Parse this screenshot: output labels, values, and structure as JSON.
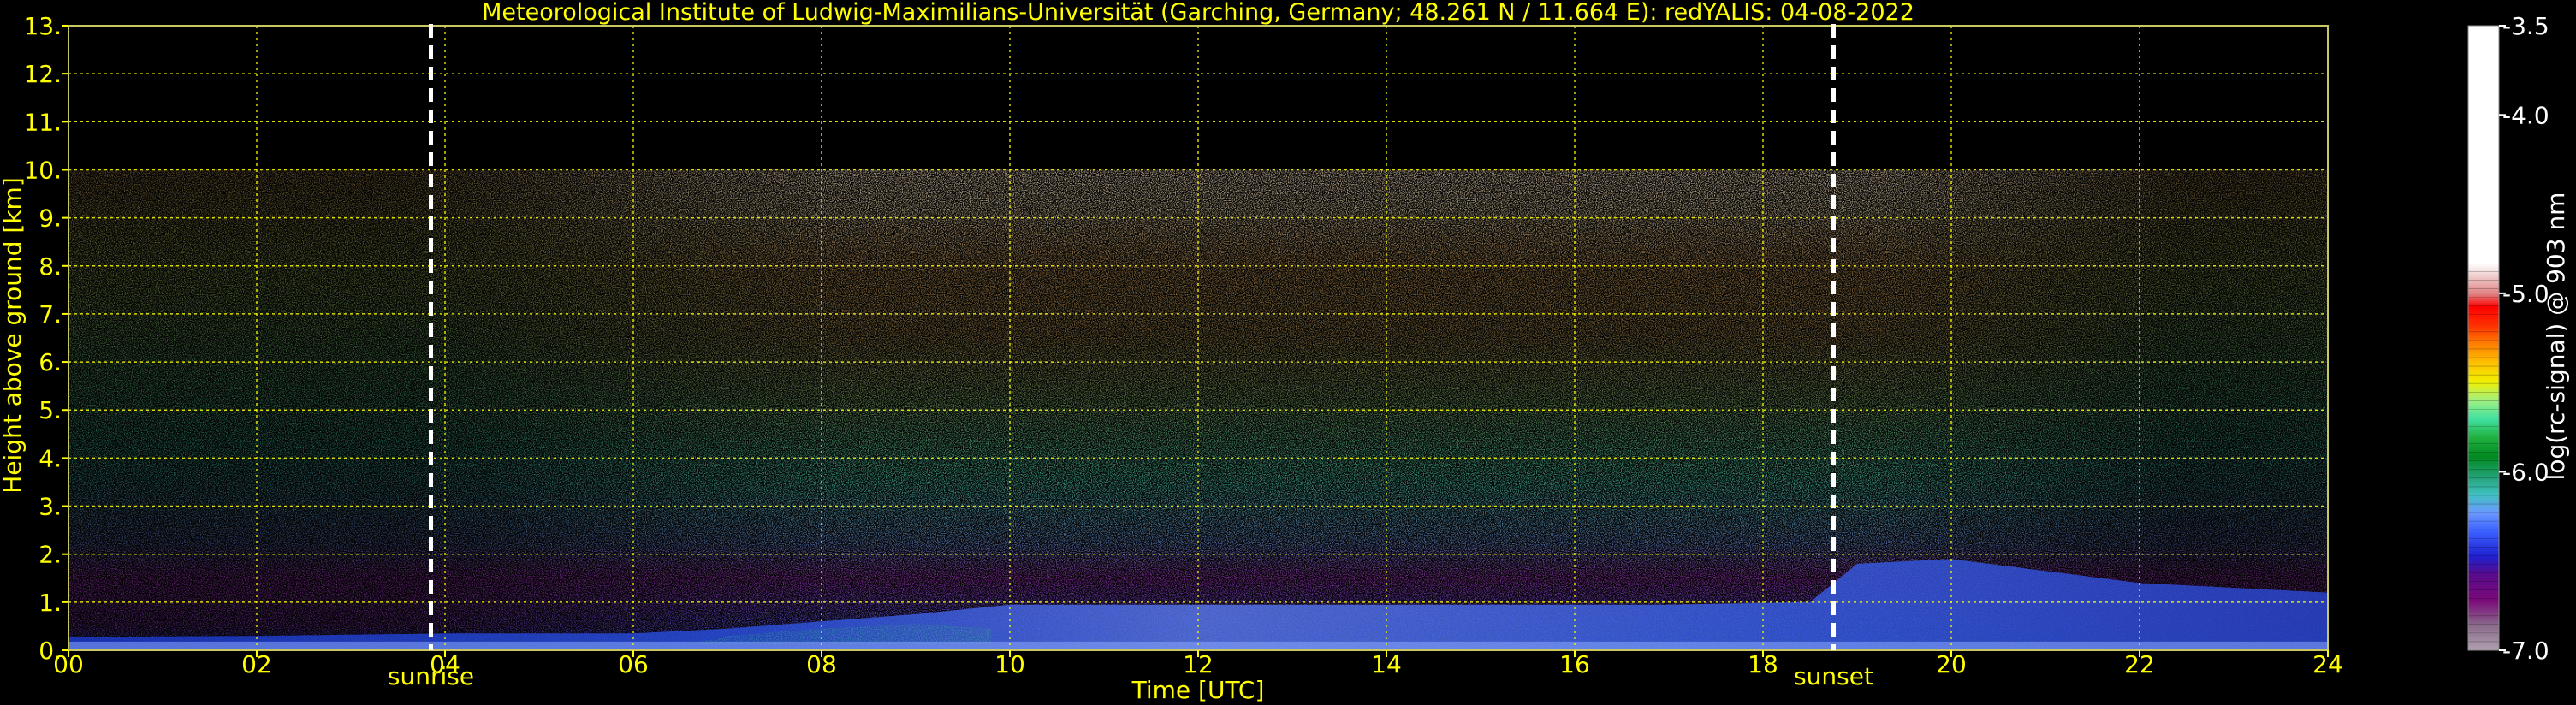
{
  "chart_data": {
    "type": "heatmap",
    "title": "Meteorological Institute of Ludwig-Maximilians-Universität (Garching, Germany; 48.261 N / 11.664 E):    redYALIS: 04-08-2022",
    "xlabel": "Time [UTC]",
    "ylabel": "Height above ground [km]",
    "xlim": [
      0,
      24
    ],
    "ylim": [
      0,
      13
    ],
    "x_ticks": [
      "00",
      "02",
      "04",
      "06",
      "08",
      "10",
      "12",
      "14",
      "16",
      "18",
      "20",
      "22",
      "24"
    ],
    "y_ticks": [
      "0.",
      "1.",
      "2.",
      "3.",
      "4.",
      "5.",
      "6.",
      "7.",
      "8.",
      "9.",
      "10.",
      "11.",
      "12.",
      "13."
    ],
    "grid": true,
    "data_top_km": 10,
    "markers": [
      {
        "label": "sunrise",
        "x": 3.85
      },
      {
        "label": "sunset",
        "x": 18.75
      }
    ],
    "colorbar": {
      "label": "log(rc-signal) @ 903 nm",
      "range": [
        -7.0,
        -3.5
      ],
      "ticks": [
        "-3.5",
        "-4.0",
        "-5.0",
        "-6.0",
        "-7.0"
      ],
      "tick_values": [
        -3.5,
        -4.0,
        -5.0,
        -6.0,
        -7.0
      ]
    }
  },
  "colors": {
    "text": "#ffff00",
    "grid": "#ffff00",
    "frame": "#c8c860",
    "marker": "#ffffff",
    "colorbar_ticks": "#ffffff"
  }
}
